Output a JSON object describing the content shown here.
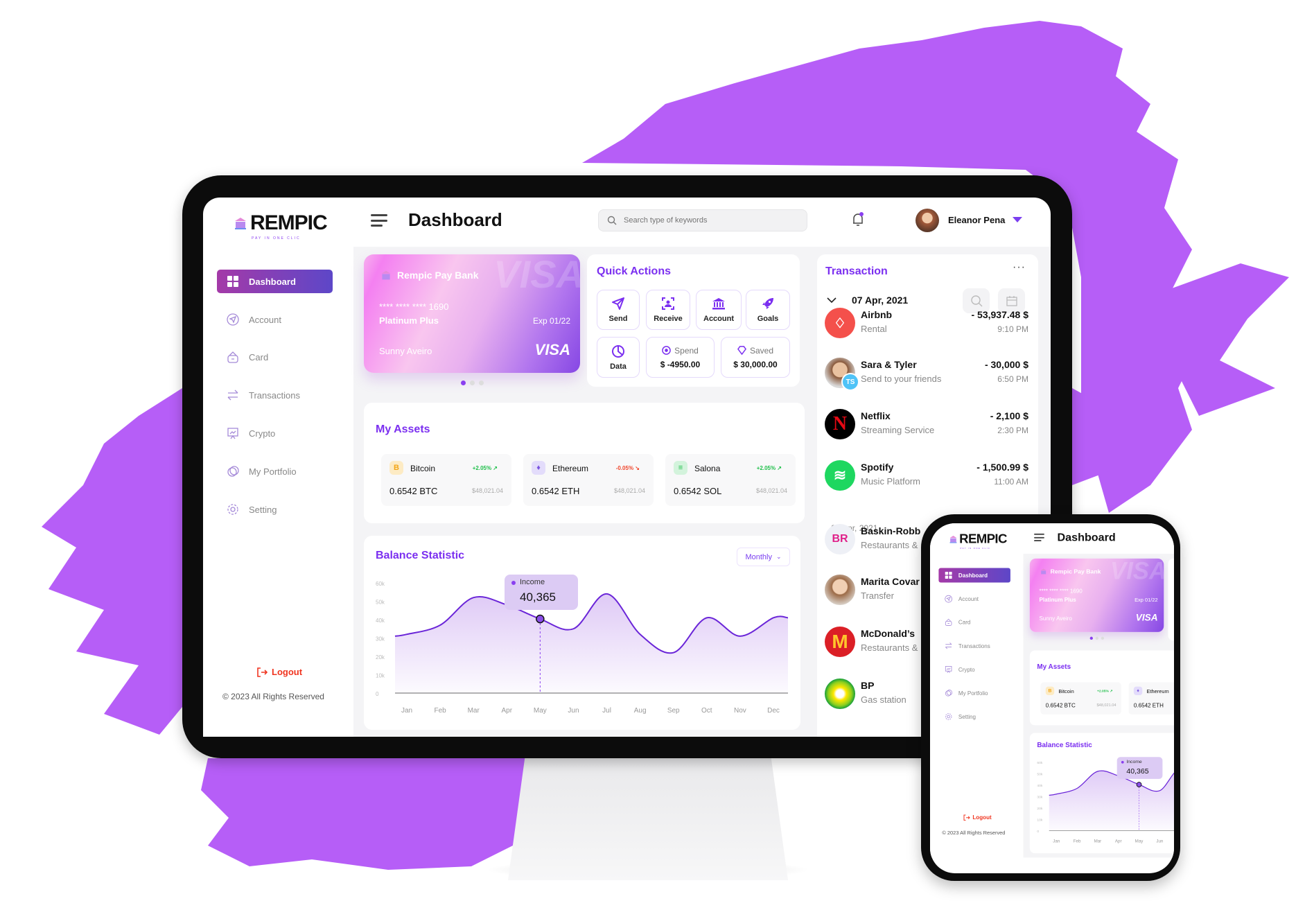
{
  "colors": {
    "accent": "#7b2ff0",
    "splash": "#b65ef7",
    "logout": "#f0341f",
    "positive": "#1fbf4a",
    "negative": "#f0452b"
  },
  "logo": {
    "name": "REMPIC",
    "tagline": "PAY IN ONE CLIC"
  },
  "header": {
    "title": "Dashboard",
    "search_placeholder": "Search type of keywords",
    "user_name": "Eleanor Pena"
  },
  "sidebar": {
    "items": [
      {
        "label": "Dashboard",
        "icon": "grid-icon",
        "active": true
      },
      {
        "label": "Account",
        "icon": "send-icon"
      },
      {
        "label": "Card",
        "icon": "wallet-icon"
      },
      {
        "label": "Transactions",
        "icon": "swap-icon"
      },
      {
        "label": "Crypto",
        "icon": "presentation-chart-icon"
      },
      {
        "label": "My Portfolio",
        "icon": "coins-icon"
      },
      {
        "label": "Setting",
        "icon": "gear-icon"
      }
    ],
    "logout": "Logout",
    "copyright": "© 2023 All Rights Reserved"
  },
  "card": {
    "bank": "Rempic Pay Bank",
    "watermark": "VISA",
    "number": "**** ****  **** 1690",
    "tier": "Platinum Plus",
    "expiry": "Exp 01/22",
    "holder": "Sunny Aveiro",
    "brand": "VISA",
    "slide": 1,
    "slides": 3
  },
  "quick_actions": {
    "title": "Quick Actions",
    "buttons": [
      "Send",
      "Receive",
      "Account",
      "Goals",
      "Data"
    ],
    "spend": {
      "label": "Spend",
      "value": "$ -4950.00"
    },
    "saved": {
      "label": "Saved",
      "value": "$ 30,000.00"
    }
  },
  "assets": {
    "title": "My Assets",
    "items": [
      {
        "name": "Bitcoin",
        "symbol": "B",
        "change": "+2.05%",
        "direction": "up",
        "amount": "0.6542 BTC",
        "usd": "$48,021.04"
      },
      {
        "name": "Ethereum",
        "symbol": "♦",
        "change": "-0.05%",
        "direction": "down",
        "amount": "0.6542 ETH",
        "usd": "$48,021.04"
      },
      {
        "name": "Salona",
        "symbol": "≡",
        "change": "+2.05%",
        "direction": "up",
        "amount": "0.6542 SOL",
        "usd": "$48,021.04"
      }
    ]
  },
  "balance": {
    "title": "Balance Statistic",
    "period": "Monthly",
    "tooltip": {
      "label": "Income",
      "value": "40,365",
      "month": "May"
    }
  },
  "chart_data": {
    "type": "area",
    "title": "Balance Statistic",
    "categories": [
      "Jan",
      "Feb",
      "Mar",
      "Apr",
      "May",
      "Jun",
      "Jul",
      "Aug",
      "Sep",
      "Oct",
      "Nov",
      "Dec"
    ],
    "series": [
      {
        "name": "Income",
        "values": [
          32000,
          37000,
          52000,
          48000,
          40365,
          35000,
          54000,
          32000,
          22000,
          41000,
          31000,
          41000
        ]
      }
    ],
    "yticks": [
      "0",
      "10k",
      "20k",
      "30k",
      "40k",
      "50k",
      "60k"
    ],
    "ylim": [
      0,
      60000
    ],
    "grid": false,
    "legend": "none"
  },
  "transactions": {
    "title": "Transaction",
    "date": "07 Apr, 2021",
    "date2": "06 Apr, 2021",
    "items": [
      {
        "name": "Airbnb",
        "sub": "Rental",
        "amount": "- 53,937.48 $",
        "time": "9:10 PM",
        "logo": "airbnb"
      },
      {
        "name": "Sara & Tyler",
        "sub": "Send to your friends",
        "amount": "- 30,000 $",
        "time": "6:50 PM",
        "logo": "photo",
        "badge": "TS"
      },
      {
        "name": "Netflix",
        "sub": "Streaming Service",
        "amount": "- 2,100 $",
        "time": "2:30 PM",
        "logo": "netflix"
      },
      {
        "name": "Spotify",
        "sub": "Music Platform",
        "amount": "- 1,500.99 $",
        "time": "11:00 AM",
        "logo": "spotify"
      },
      {
        "name": "Baskin-Robb",
        "sub": "Restaurants &",
        "logo": "br",
        "group": 2
      },
      {
        "name": "Marita Covar",
        "sub": "Transfer",
        "logo": "photo2",
        "group": 2
      },
      {
        "name": "McDonald’s",
        "sub": "Restaurants &",
        "logo": "mcd",
        "group": 2
      },
      {
        "name": "BP",
        "sub": "Gas station",
        "logo": "bp",
        "group": 2
      }
    ]
  }
}
